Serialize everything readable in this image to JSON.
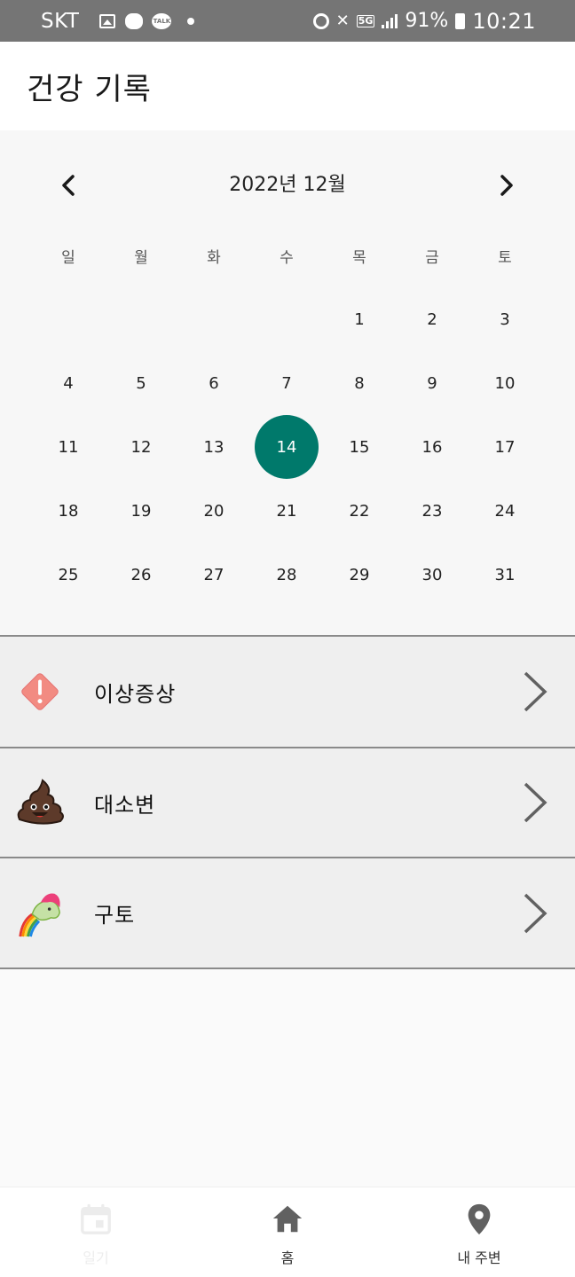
{
  "status_bar": {
    "carrier": "SKT",
    "battery": "91%",
    "time": "10:21",
    "network": "5G",
    "icons": [
      "gallery-icon",
      "game-icon",
      "kakaotalk-icon",
      "notification-dot-icon",
      "alarm-icon",
      "mute-icon",
      "5g-icon",
      "signal-icon",
      "battery-charging-icon"
    ],
    "talk_label": "TALK"
  },
  "app_bar": {
    "title": "건강 기록"
  },
  "calendar": {
    "month_label": "2022년 12월",
    "prev_icon": "chevron-left-icon",
    "next_icon": "chevron-right-icon",
    "weekdays": [
      "일",
      "월",
      "화",
      "수",
      "목",
      "금",
      "토"
    ],
    "days": [
      "",
      "",
      "",
      "",
      "1",
      "2",
      "3",
      "4",
      "5",
      "6",
      "7",
      "8",
      "9",
      "10",
      "11",
      "12",
      "13",
      "14",
      "15",
      "16",
      "17",
      "18",
      "19",
      "20",
      "21",
      "22",
      "23",
      "24",
      "25",
      "26",
      "27",
      "28",
      "29",
      "30",
      "31"
    ],
    "selected_day": "14",
    "selected_color": "#00796b"
  },
  "menu": {
    "items": [
      {
        "label": "이상증상",
        "icon": "warning-diamond-icon"
      },
      {
        "label": "대소변",
        "icon": "poop-emoji-icon"
      },
      {
        "label": "구토",
        "icon": "unicorn-vomit-icon"
      }
    ],
    "arrow_icon": "chevron-right-icon"
  },
  "bottom_nav": {
    "items": [
      {
        "label": "일기",
        "icon": "calendar-icon",
        "enabled": false
      },
      {
        "label": "홈",
        "icon": "home-icon",
        "enabled": true
      },
      {
        "label": "내 주변",
        "icon": "location-pin-icon",
        "enabled": true
      }
    ]
  }
}
